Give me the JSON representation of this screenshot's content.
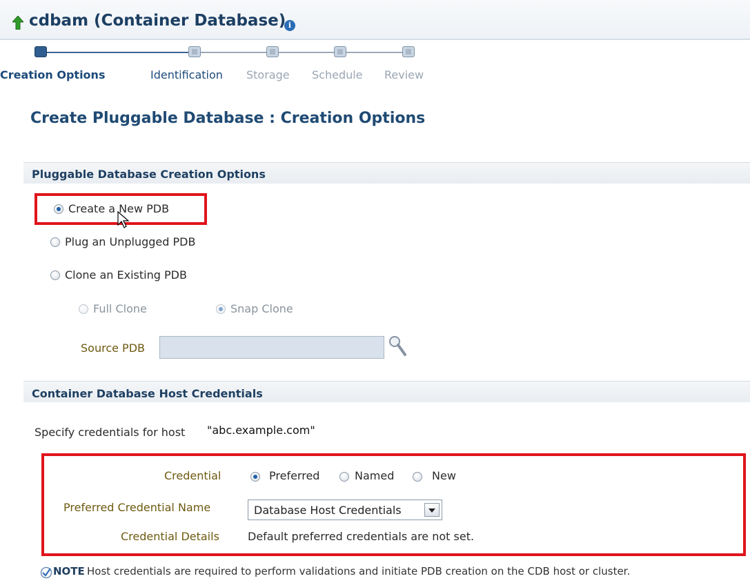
{
  "header": {
    "title": "cdbam (Container Database)",
    "up_icon": "green-up-arrow-icon",
    "info_icon": "info-icon",
    "info_glyph": "i"
  },
  "train": {
    "steps": [
      {
        "label": "Creation Options",
        "state": "active"
      },
      {
        "label": "Identification",
        "state": "next"
      },
      {
        "label": "Storage",
        "state": "disabled"
      },
      {
        "label": "Schedule",
        "state": "disabled"
      },
      {
        "label": "Review",
        "state": "disabled"
      }
    ]
  },
  "page": {
    "heading": "Create Pluggable Database : Creation Options"
  },
  "creation_options": {
    "section_title": "Pluggable Database Creation Options",
    "options": [
      {
        "label": "Create a New PDB",
        "checked": true
      },
      {
        "label": "Plug an Unplugged PDB",
        "checked": false
      },
      {
        "label": "Clone an Existing PDB",
        "checked": false
      }
    ],
    "clone_types": [
      {
        "label": "Full Clone",
        "checked": false,
        "disabled": true
      },
      {
        "label": "Snap Clone",
        "checked": true,
        "disabled": true
      }
    ],
    "source_pdb_label": "Source PDB",
    "source_pdb_value": ""
  },
  "host_credentials": {
    "section_title": "Container Database Host Credentials",
    "description_prefix": "Specify credentials for host",
    "host_name": "\"abc.example.com\"",
    "credential_label": "Credential",
    "credential_options": [
      {
        "label": "Preferred",
        "checked": true
      },
      {
        "label": "Named",
        "checked": false
      },
      {
        "label": "New",
        "checked": false
      }
    ],
    "preferred_name_label": "Preferred Credential Name",
    "preferred_name_value": "Database Host Credentials",
    "details_label": "Credential Details",
    "details_value": "Default preferred credentials are not set."
  },
  "note": {
    "label": "NOTE",
    "text": "Host credentials are required to perform validations and initiate PDB creation on the CDB host or cluster."
  },
  "colors": {
    "highlight": "#e0141b",
    "title": "#1c3f63",
    "label": "#6e5a10"
  }
}
